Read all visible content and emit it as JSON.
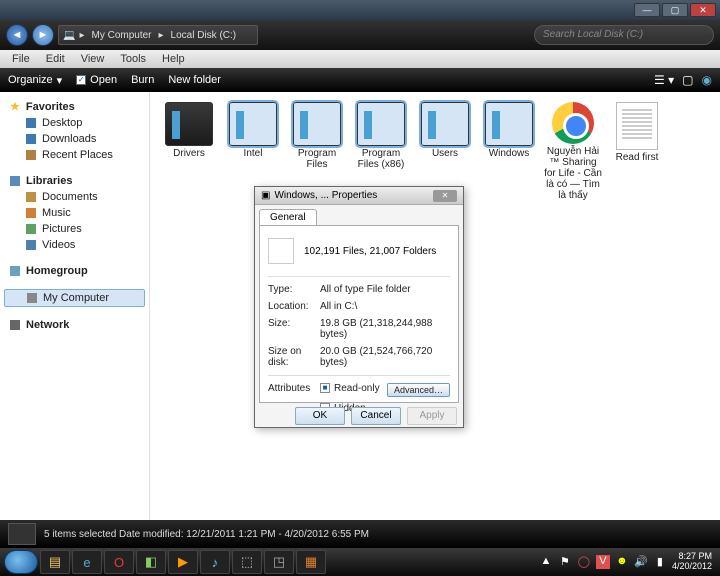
{
  "window": {
    "title": "Local Disk (C:)"
  },
  "nav": {
    "crumb1": "My Computer",
    "crumb2": "Local Disk (C:)",
    "search_placeholder": "Search Local Disk (C:)"
  },
  "menu": {
    "file": "File",
    "edit": "Edit",
    "view": "View",
    "tools": "Tools",
    "help": "Help"
  },
  "toolbar": {
    "organize": "Organize",
    "open": "Open",
    "burn": "Burn",
    "new_folder": "New folder"
  },
  "sidebar": {
    "favorites": "Favorites",
    "fav_items": {
      "desktop": "Desktop",
      "downloads": "Downloads",
      "recent": "Recent Places"
    },
    "libraries": "Libraries",
    "lib_items": {
      "documents": "Documents",
      "music": "Music",
      "pictures": "Pictures",
      "videos": "Videos"
    },
    "homegroup": "Homegroup",
    "computer": "My Computer",
    "network": "Network"
  },
  "folders": [
    {
      "label": "Drivers",
      "type": "folder"
    },
    {
      "label": "Intel",
      "type": "folder",
      "sel": true
    },
    {
      "label": "Program Files",
      "type": "folder",
      "sel": true
    },
    {
      "label": "Program Files (x86)",
      "type": "folder",
      "sel": true
    },
    {
      "label": "Users",
      "type": "folder",
      "sel": true
    },
    {
      "label": "Windows",
      "type": "folder",
      "sel": true
    },
    {
      "label": "Nguyễn Hải ™ Sharing for Life - Cần là có — Tìm là thấy",
      "type": "chrome"
    },
    {
      "label": "Read first",
      "type": "doc"
    }
  ],
  "dialog": {
    "title": "Windows, ... Properties",
    "tab_general": "General",
    "summary": "102,191 Files, 21,007 Folders",
    "type_k": "Type:",
    "type_v": "All of type File folder",
    "loc_k": "Location:",
    "loc_v": "All in C:\\",
    "size_k": "Size:",
    "size_v": "19.8 GB (21,318,244,988 bytes)",
    "sod_k": "Size on disk:",
    "sod_v": "20.0 GB (21,524,766,720 bytes)",
    "attr_k": "Attributes",
    "readonly": "Read-only",
    "hidden": "Hidden",
    "advanced": "Advanced…",
    "ok": "OK",
    "cancel": "Cancel",
    "apply": "Apply"
  },
  "status": {
    "text": "5 items selected   Date modified: 12/21/2011 1:21 PM - 4/20/2012 6:55 PM"
  },
  "tray": {
    "time": "8:27 PM",
    "date": "4/20/2012"
  }
}
